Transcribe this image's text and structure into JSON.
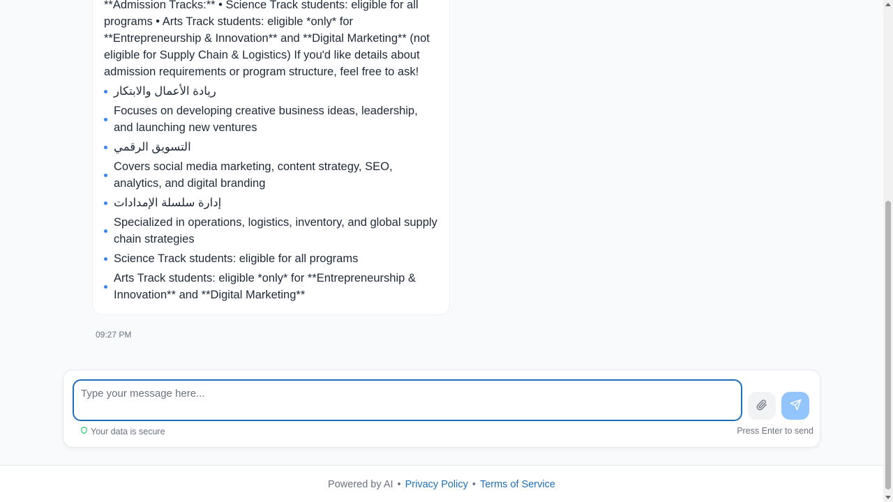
{
  "message": {
    "text": "**Admission Tracks:** • Science Track students: eligible for all programs • Arts Track students: eligible *only* for **Entrepreneurship & Innovation** and **Digital Marketing** (not eligible for Supply Chain & Logistics) If you'd like details about admission requirements or program structure, feel free to ask!",
    "bullets": [
      "ريادة الأعمال والابتكار",
      "Focuses on developing creative business ideas, leadership, and launching new ventures",
      "التسويق الرقمي",
      "Covers social media marketing, content strategy, SEO, analytics, and digital branding",
      "إدارة سلسلة الإمدادات",
      "Specialized in operations, logistics, inventory, and global supply chain strategies",
      "Science Track students: eligible for all programs",
      "Arts Track students: eligible *only* for **Entrepreneurship & Innovation** and **Digital Marketing**"
    ],
    "timestamp": "09:27 PM"
  },
  "composer": {
    "placeholder": "Type your message here...",
    "value": "",
    "secure_text": "Your data is secure",
    "hint": "Press Enter to send",
    "attach_icon": "paperclip-icon",
    "send_icon": "send-icon"
  },
  "footer": {
    "powered": "Powered by AI",
    "separator": "•",
    "privacy": "Privacy Policy",
    "terms": "Terms of Service"
  },
  "colors": {
    "accent": "#1d6fb8",
    "bullet": "#3b82f6",
    "send_button": "#93c5fd",
    "secure_icon": "#22c55e"
  }
}
